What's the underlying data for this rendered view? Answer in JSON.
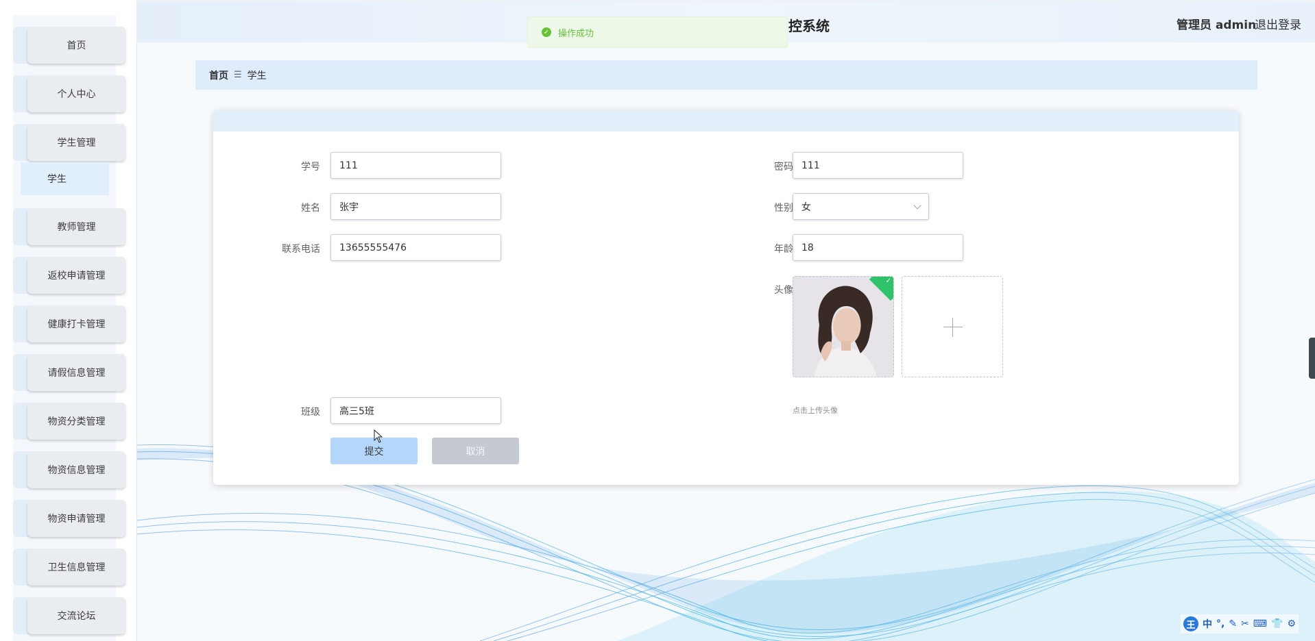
{
  "header": {
    "title": "控系统",
    "admin_label": "管理员 admin",
    "logout": "退出登录"
  },
  "toast": {
    "text": "操作成功",
    "icon": "check-circle-icon"
  },
  "sidebar": {
    "items": [
      {
        "label": "首页"
      },
      {
        "label": "个人中心"
      },
      {
        "label": "学生管理"
      },
      {
        "label": "教师管理"
      },
      {
        "label": "返校申请管理"
      },
      {
        "label": "健康打卡管理"
      },
      {
        "label": "请假信息管理"
      },
      {
        "label": "物资分类管理"
      },
      {
        "label": "物资信息管理"
      },
      {
        "label": "物资申请管理"
      },
      {
        "label": "卫生信息管理"
      },
      {
        "label": "交流论坛"
      }
    ],
    "submenu": {
      "label": "学生"
    }
  },
  "breadcrumb": {
    "home": "首页",
    "separator": "☰",
    "current": "学生"
  },
  "form": {
    "student_no_label": "学号",
    "student_no_value": "111",
    "password_label": "密码",
    "password_value": "111",
    "name_label": "姓名",
    "name_value": "张宇",
    "gender_label": "性别",
    "gender_value": "女",
    "phone_label": "联系电话",
    "phone_value": "13655555476",
    "age_label": "年龄",
    "age_value": "18",
    "avatar_label": "头像",
    "upload_tip": "点击上传头像",
    "class_label": "班级",
    "class_value": "高三5班",
    "submit": "提交",
    "cancel": "取消"
  },
  "ime_toolbar": {
    "logo": "王",
    "mode": "中",
    "icons": [
      "punctuation-icon",
      "pen-icon",
      "scissors-icon",
      "keyboard-icon",
      "shirt-icon",
      "gear-icon"
    ]
  },
  "colors": {
    "accent": "#b4d6fb",
    "success": "#67c23a",
    "breadcrumb_bg": "#deecfb"
  }
}
